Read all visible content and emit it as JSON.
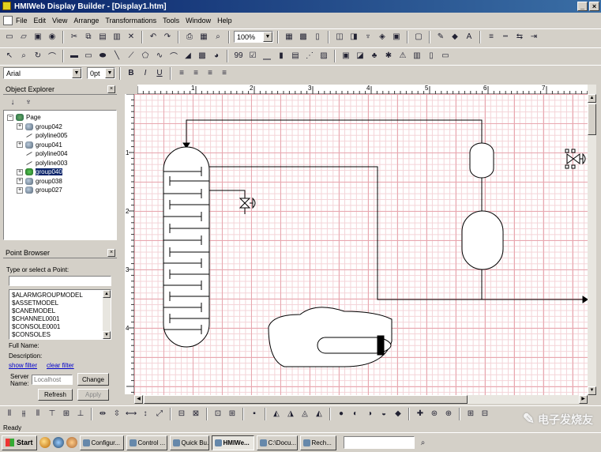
{
  "window": {
    "title": "HMIWeb Display Builder - [Display1.htm]",
    "buttons": [
      "_",
      "×"
    ]
  },
  "menu": [
    "File",
    "Edit",
    "View",
    "Arrange",
    "Transformations",
    "Tools",
    "Window",
    "Help"
  ],
  "toolbar1": {
    "zoom": "100%"
  },
  "format_bar": {
    "font": "Arial",
    "size": "0pt",
    "bold": "B",
    "italic": "I",
    "underline": "U"
  },
  "object_explorer": {
    "title": "Object Explorer",
    "root": "Page",
    "items": [
      {
        "label": "group042",
        "type": "group",
        "expand": "+"
      },
      {
        "label": "polyline005",
        "type": "polyline",
        "expand": ""
      },
      {
        "label": "group041",
        "type": "group",
        "expand": "+"
      },
      {
        "label": "polyline004",
        "type": "polyline",
        "expand": ""
      },
      {
        "label": "polyline003",
        "type": "polyline",
        "expand": ""
      },
      {
        "label": "group040",
        "type": "group",
        "expand": "+",
        "selected": true
      },
      {
        "label": "group038",
        "type": "group",
        "expand": "+"
      },
      {
        "label": "group027",
        "type": "group",
        "expand": "+"
      }
    ]
  },
  "point_browser": {
    "title": "Point Browser",
    "prompt": "Type or select a Point:",
    "points": [
      "$ALARMGROUPMODEL",
      "$ASSETMODEL",
      "$CANEMODEL",
      "$CHANNEL0001",
      "$CONSOLE0001",
      "$CONSOLES"
    ],
    "full_name_label": "Full Name:",
    "description_label": "Description:",
    "show_filter": "show filter",
    "clear_filter": "clear filter",
    "server_label": "Server Name:",
    "server_placeholder": "Localhost",
    "change_button": "Change",
    "refresh_button": "Refresh",
    "apply_button": "Apply"
  },
  "ruler": {
    "h_ticks": [
      "1",
      "2",
      "3",
      "4",
      "5",
      "6",
      "7"
    ],
    "v_ticks": [
      "1",
      "2",
      "3",
      "4"
    ]
  },
  "status": "Ready",
  "taskbar": {
    "start": "Start",
    "tasks": [
      "Configur...",
      "Control ...",
      "Quick Bu...",
      "HMIWe...",
      "C:\\Docu...",
      "Rech..."
    ],
    "active_index": 3
  },
  "watermark": "电子发烧友"
}
